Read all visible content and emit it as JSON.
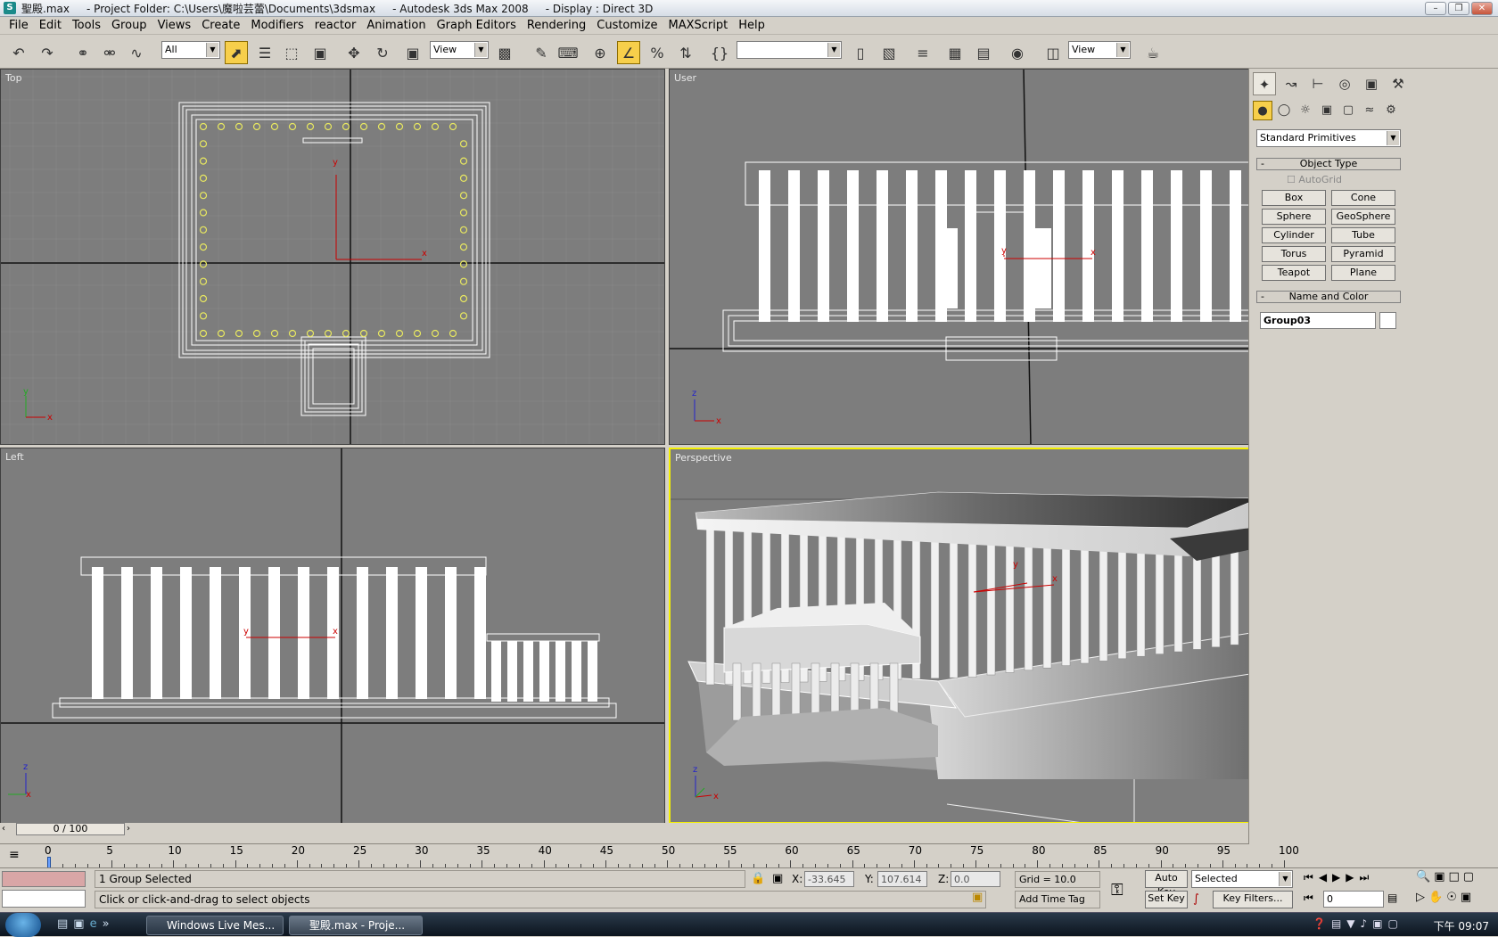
{
  "window": {
    "title": "聖殿.max     - Project Folder: C:\\Users\\魔啦芸蕾\\Documents\\3dsmax     - Autodesk 3ds Max 2008     - Display : Direct 3D",
    "icon": "3dsmax-logo-icon"
  },
  "menu": [
    "File",
    "Edit",
    "Tools",
    "Group",
    "Views",
    "Create",
    "Modifiers",
    "reactor",
    "Animation",
    "Graph Editors",
    "Rendering",
    "Customize",
    "MAXScript",
    "Help"
  ],
  "toolbar": {
    "selection_filter": "All",
    "reference_coord": "View",
    "named_selection": "",
    "render_type": "View"
  },
  "viewports": {
    "top": {
      "label": "Top"
    },
    "user": {
      "label": "User"
    },
    "left": {
      "label": "Left"
    },
    "perspective": {
      "label": "Perspective"
    },
    "axes": {
      "x": "x",
      "y": "y",
      "z": "z"
    }
  },
  "command_panel": {
    "category": "Standard Primitives",
    "object_type_title": "Object Type",
    "autogrid": "AutoGrid",
    "buttons": [
      "Box",
      "Cone",
      "Sphere",
      "GeoSphere",
      "Cylinder",
      "Tube",
      "Torus",
      "Pyramid",
      "Teapot",
      "Plane"
    ],
    "name_color_title": "Name and Color",
    "object_name": "Group03",
    "object_color": "#ffffff"
  },
  "timeline": {
    "frame_display": "0 / 100",
    "ticks": [
      "0",
      "5",
      "10",
      "15",
      "20",
      "25",
      "30",
      "35",
      "40",
      "45",
      "50",
      "55",
      "60",
      "65",
      "70",
      "75",
      "80",
      "85",
      "90",
      "95",
      "100"
    ]
  },
  "status": {
    "selection": "1 Group Selected",
    "prompt": "Click or click-and-drag to select objects",
    "x_label": "X:",
    "x_value": "-33.645",
    "y_label": "Y:",
    "y_value": "107.614",
    "z_label": "Z:",
    "z_value": "0.0",
    "grid": "Grid = 10.0",
    "add_time_tag": "Add Time Tag",
    "auto_key": "Auto Key",
    "set_key": "Set Key",
    "key_mode": "Selected",
    "key_filters": "Key Filters...",
    "current_frame": "0"
  },
  "taskbar": {
    "items": [
      "Windows Live Mes...",
      "聖殿.max     - Proje..."
    ],
    "clock": "下午 09:07"
  }
}
